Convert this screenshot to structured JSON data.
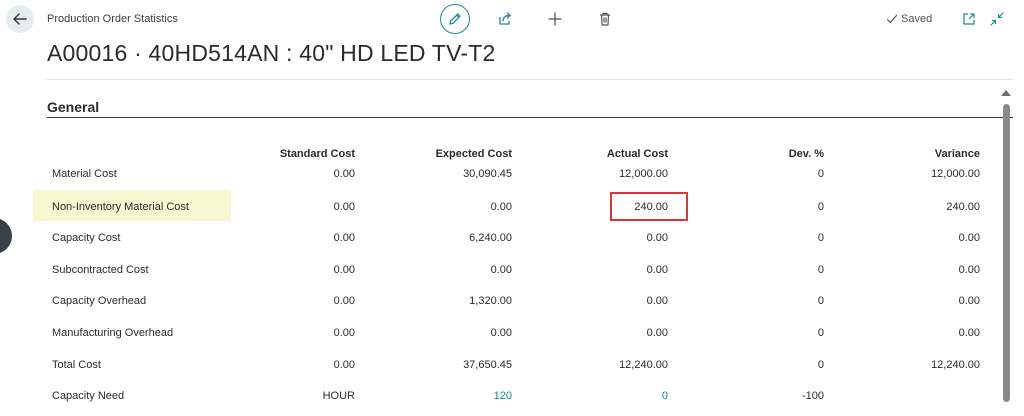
{
  "header": {
    "breadcrumb": "Production Order Statistics",
    "status": "Saved",
    "title": "A00016 · 40HD514AN : 40\" HD LED TV-T2"
  },
  "section": {
    "title": "General"
  },
  "table": {
    "columns": [
      "Standard Cost",
      "Expected Cost",
      "Actual Cost",
      "Dev. %",
      "Variance"
    ],
    "rows": [
      {
        "label": "Material Cost",
        "cells": [
          "0.00",
          "30,090.45",
          "12,000.00",
          "0",
          "12,000.00"
        ]
      },
      {
        "label": "Non-Inventory Material Cost",
        "cells": [
          "0.00",
          "0.00",
          "240.00",
          "0",
          "240.00"
        ]
      },
      {
        "label": "Capacity Cost",
        "cells": [
          "0.00",
          "6,240.00",
          "0.00",
          "0",
          "0.00"
        ]
      },
      {
        "label": "Subcontracted Cost",
        "cells": [
          "0.00",
          "0.00",
          "0.00",
          "0",
          "0.00"
        ]
      },
      {
        "label": "Capacity Overhead",
        "cells": [
          "0.00",
          "1,320.00",
          "0.00",
          "0",
          "0.00"
        ]
      },
      {
        "label": "Manufacturing Overhead",
        "cells": [
          "0.00",
          "0.00",
          "0.00",
          "0",
          "0.00"
        ]
      },
      {
        "label": "Total Cost",
        "cells": [
          "0.00",
          "37,650.45",
          "12,240.00",
          "0",
          "12,240.00"
        ]
      },
      {
        "label": "Capacity Need",
        "cells": [
          "HOUR",
          "120",
          "0",
          "-100",
          ""
        ]
      }
    ]
  },
  "colors": {
    "accent": "#148a8e",
    "highlight_row": "#f7f8d1",
    "highlight_box": "#d9363e"
  },
  "icons": {
    "back": "arrow-left-icon",
    "edit": "pencil-icon",
    "share": "share-icon",
    "new": "plus-icon",
    "delete": "trash-icon",
    "saved": "checkmark-icon",
    "popout": "open-in-new-window-icon",
    "collapse": "collapse-icon"
  }
}
